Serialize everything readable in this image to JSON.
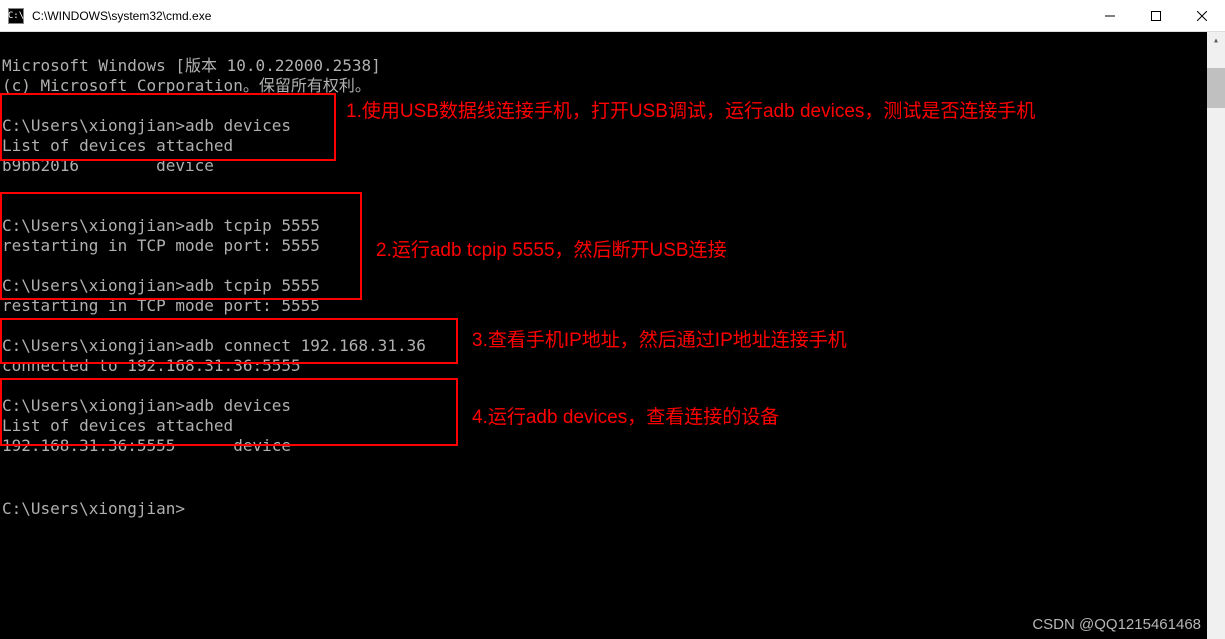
{
  "window": {
    "title": "C:\\WINDOWS\\system32\\cmd.exe",
    "icon_label": "C:\\"
  },
  "terminal": {
    "header1": "Microsoft Windows [版本 10.0.22000.2538]",
    "header2": "(c) Microsoft Corporation。保留所有权利。",
    "block1_line1": "C:\\Users\\xiongjian>adb devices",
    "block1_line2": "List of devices attached",
    "block1_line3": "b9bb2016        device",
    "block2_line1": "C:\\Users\\xiongjian>adb tcpip 5555",
    "block2_line2": "restarting in TCP mode port: 5555",
    "block2_line3": "C:\\Users\\xiongjian>adb tcpip 5555",
    "block2_line4": "restarting in TCP mode port: 5555",
    "block3_line1": "C:\\Users\\xiongjian>adb connect 192.168.31.36",
    "block3_line2": "connected to 192.168.31.36:5555",
    "block4_line1": "C:\\Users\\xiongjian>adb devices",
    "block4_line2": "List of devices attached",
    "block4_line3": "192.168.31.36:5555      device",
    "prompt_final": "C:\\Users\\xiongjian>"
  },
  "annotations": {
    "a1": "1.使用USB数据线连接手机，打开USB调试，运行adb devices，测试是否连接手机",
    "a2": "2.运行adb tcpip 5555，然后断开USB连接",
    "a3": "3.查看手机IP地址，然后通过IP地址连接手机",
    "a4": "4.运行adb devices，查看连接的设备"
  },
  "watermark": "CSDN @QQ1215461468"
}
